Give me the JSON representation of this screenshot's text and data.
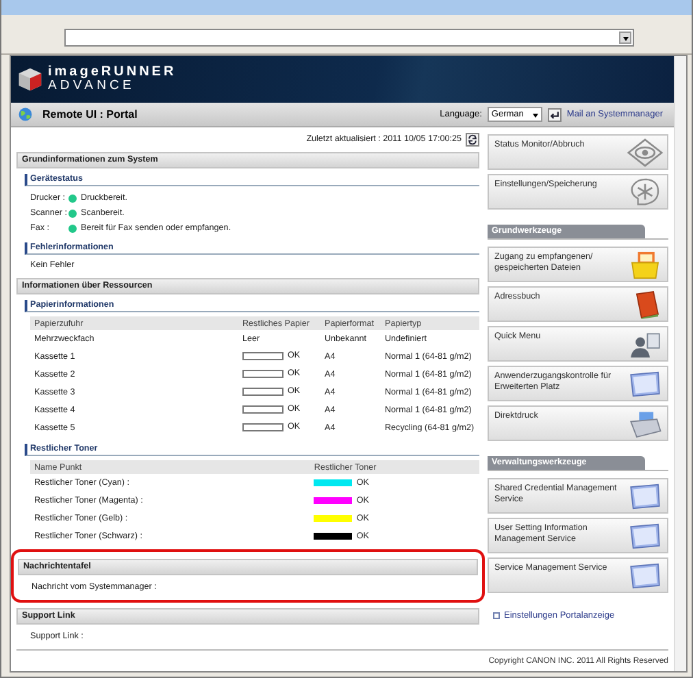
{
  "header": {
    "logo_line1": "imageRUNNER",
    "logo_line2": "ADVANCE"
  },
  "portal_bar": {
    "title": "Remote UI : Portal",
    "language_label": "Language:",
    "language_value": "German",
    "mail_link": "Mail an Systemmanager"
  },
  "last_updated": "Zuletzt aktualisiert : 2011 10/05 17:00:25",
  "system_info": {
    "title": "Grundinformationen zum System",
    "device_status": {
      "title": "Gerätestatus",
      "rows": [
        {
          "label": "Drucker :",
          "status": "Druckbereit.",
          "color": "#22c88a"
        },
        {
          "label": "Scanner :",
          "status": "Scanbereit.",
          "color": "#22c88a"
        },
        {
          "label": "Fax :",
          "status": "Bereit für Fax senden oder empfangen.",
          "color": "#22c88a"
        }
      ]
    },
    "errors": {
      "title": "Fehlerinformationen",
      "text": "Kein Fehler"
    }
  },
  "resources": {
    "title": "Informationen über Ressourcen",
    "paper": {
      "title": "Papierinformationen",
      "columns": [
        "Papierzufuhr",
        "Restliches Papier",
        "Papierformat",
        "Papiertyp"
      ],
      "rows": [
        {
          "source": "Mehrzweckfach",
          "kind": "text",
          "remaining": "Leer",
          "format": "Unbekannt",
          "type": "Undefiniert"
        },
        {
          "source": "Kassette 1",
          "kind": "bar",
          "remaining": "OK",
          "format": "A4",
          "type": "Normal 1 (64-81 g/m2)"
        },
        {
          "source": "Kassette 2",
          "kind": "bar",
          "remaining": "OK",
          "format": "A4",
          "type": "Normal 1 (64-81 g/m2)"
        },
        {
          "source": "Kassette 3",
          "kind": "bar",
          "remaining": "OK",
          "format": "A4",
          "type": "Normal 1 (64-81 g/m2)"
        },
        {
          "source": "Kassette 4",
          "kind": "bar",
          "remaining": "OK",
          "format": "A4",
          "type": "Normal 1 (64-81 g/m2)"
        },
        {
          "source": "Kassette 5",
          "kind": "bar",
          "remaining": "OK",
          "format": "A4",
          "type": "Recycling (64-81 g/m2)"
        }
      ]
    },
    "toner": {
      "title": "Restlicher Toner",
      "columns": [
        "Name Punkt",
        "Restlicher Toner"
      ],
      "rows": [
        {
          "name": "Restlicher Toner (Cyan) :",
          "color": "#00e8f0",
          "level": 1,
          "status": "OK"
        },
        {
          "name": "Restlicher Toner (Magenta) :",
          "color": "#ff00ff",
          "level": 1,
          "status": "OK"
        },
        {
          "name": "Restlicher Toner (Gelb) :",
          "color": "#ffff00",
          "level": 1,
          "status": "OK"
        },
        {
          "name": "Restlicher Toner (Schwarz) :",
          "color": "#000000",
          "level": 1,
          "status": "OK"
        }
      ]
    }
  },
  "message_board": {
    "title": "Nachrichtentafel",
    "text": "Nachricht vom Systemmanager :",
    "highlighted": true
  },
  "support": {
    "title": "Support Link",
    "text": "Support Link :"
  },
  "sidebar": {
    "top_buttons": [
      {
        "label": "Status Monitor/Abbruch",
        "kind": "eye"
      },
      {
        "label": "Einstellungen/Speicherung",
        "kind": "asterisk"
      }
    ],
    "groups": [
      {
        "title": "Grundwerkzeuge",
        "buttons": [
          {
            "label": "Zugang zu empfangenen/ gespeicherten Dateien",
            "kind": "box"
          },
          {
            "label": "Adressbuch",
            "kind": "book"
          },
          {
            "label": "Quick Menu",
            "kind": "person"
          },
          {
            "label": "Anwenderzugangskontrolle für Erweiterten Platz",
            "kind": "screen"
          },
          {
            "label": "Direktdruck",
            "kind": "printer"
          }
        ]
      },
      {
        "title": "Verwaltungswerkzeuge",
        "buttons": [
          {
            "label": "Shared Credential Management Service",
            "kind": "screen"
          },
          {
            "label": "User Setting Information Management Service",
            "kind": "screen"
          },
          {
            "label": "Service Management Service",
            "kind": "screen"
          }
        ]
      }
    ],
    "portal_link": "Einstellungen Portalanzeige"
  },
  "footer": {
    "copyright": "Copyright CANON INC. 2011 All Rights Reserved"
  }
}
